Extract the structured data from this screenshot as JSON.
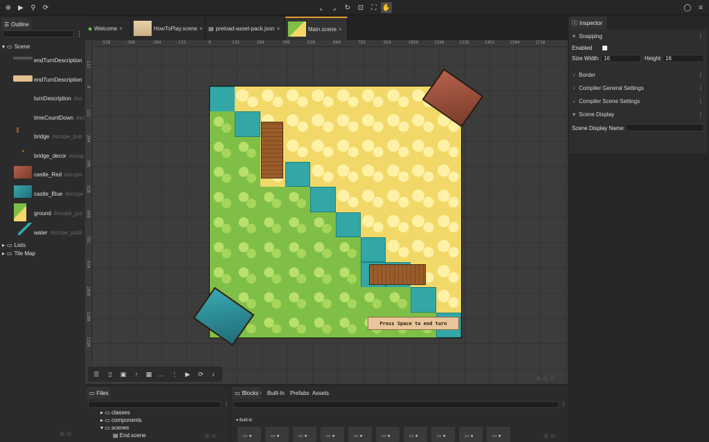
{
  "toolbar": {
    "left_icons": [
      "add-object-icon",
      "play-icon",
      "search-icon",
      "settings-icon"
    ],
    "center_icons": [
      "translate-tool-icon",
      "scale-tool-icon",
      "rotate-tool-icon",
      "origin-tool-icon",
      "resize-tool-icon",
      "hand-tool-icon"
    ],
    "right_icons": [
      "chat-icon",
      "menu-icon"
    ]
  },
  "outline": {
    "tab_label": "Outline",
    "scene_label": "Scene",
    "items": [
      {
        "label": "endTurnDescription",
        "scope": ""
      },
      {
        "label": "endTurnDescription",
        "scope": ""
      },
      {
        "label": "turnDescription",
        "scope": "#sc"
      },
      {
        "label": "timeCountDown",
        "scope": "#sc"
      },
      {
        "label": "bridge",
        "scope": "#scope_pub"
      },
      {
        "label": "bridge_decor",
        "scope": "#scop"
      },
      {
        "label": "castle_Red",
        "scope": "#scope"
      },
      {
        "label": "castle_Blue",
        "scope": "#scope"
      },
      {
        "label": "ground",
        "scope": "#scope_pul"
      },
      {
        "label": "water",
        "scope": "#scope_publ"
      }
    ],
    "folders": [
      "Lists",
      "Tile Map"
    ]
  },
  "editor_tabs": [
    {
      "label": "Welcome",
      "close": "×"
    },
    {
      "label": "HowToPlay.scene",
      "close": "×"
    },
    {
      "label": "preload-asset-pack.json",
      "close": "×"
    },
    {
      "label": "Main.scene",
      "close": "×"
    }
  ],
  "rulers": {
    "top": [
      "-528",
      "-396",
      "-264",
      "-132",
      "0",
      "132",
      "264",
      "396",
      "528",
      "660",
      "792",
      "924",
      "1056",
      "1188",
      "1320",
      "1452",
      "1584",
      "1716"
    ],
    "left": [
      "-132",
      "0",
      "132",
      "264",
      "396",
      "528",
      "660",
      "792",
      "924",
      "1056",
      "1188",
      "1320"
    ]
  },
  "scene": {
    "end_turn_text": "Press Space to end turn"
  },
  "inspector": {
    "tab_label": "Inspector",
    "snapping": {
      "title": "Snapping",
      "enabled_label": "Enabled",
      "enabled": false,
      "size_width_label": "Size Width",
      "size_width": "16",
      "height_label": "Height",
      "height": "16"
    },
    "sections": [
      "Border",
      "Compiler General Settings",
      "Compiler Scene Settings",
      "Scene Display"
    ],
    "scene_display_name_label": "Scene Display Name",
    "scene_display_name": ""
  },
  "files": {
    "tab_label": "Files",
    "tree": [
      "classes",
      "components",
      "scenes",
      "End.scene"
    ]
  },
  "blocks": {
    "breadcrumb": [
      "Blocks",
      "Built-In",
      "Prefabs",
      "Assets"
    ],
    "section_label": "Built-In"
  },
  "colors": {
    "accent": "#e39b2d",
    "water": "#33a7a6",
    "sand": "#f1d868",
    "grass": "#7fbf47",
    "panel": "#2b2b2b"
  }
}
